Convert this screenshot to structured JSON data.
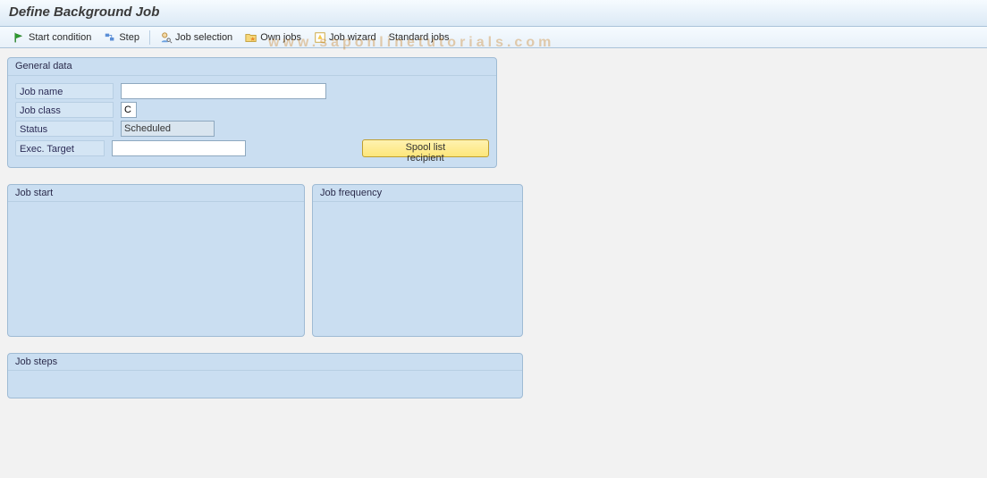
{
  "title": "Define Background Job",
  "toolbar": {
    "start_condition": "Start condition",
    "step": "Step",
    "job_selection": "Job selection",
    "own_jobs": "Own jobs",
    "job_wizard": "Job wizard",
    "standard_jobs": "Standard jobs"
  },
  "general_data": {
    "title": "General data",
    "job_name_label": "Job name",
    "job_name_value": "",
    "job_class_label": "Job class",
    "job_class_value": "C",
    "status_label": "Status",
    "status_value": "Scheduled",
    "exec_target_label": "Exec. Target",
    "exec_target_value": "",
    "spool_button": "Spool list recipient"
  },
  "panels": {
    "job_start": "Job start",
    "job_frequency": "Job frequency",
    "job_steps": "Job steps"
  },
  "watermark": "www.saponlinetutorials.com"
}
